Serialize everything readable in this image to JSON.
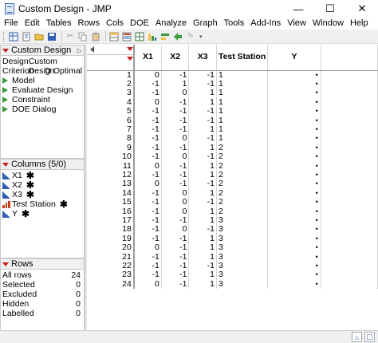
{
  "window": {
    "title": "Custom Design - JMP",
    "controls": [
      "—",
      "☐",
      "✕"
    ]
  },
  "menu": [
    "File",
    "Edit",
    "Tables",
    "Rows",
    "Cols",
    "DOE",
    "Analyze",
    "Graph",
    "Tools",
    "Add-Ins",
    "View",
    "Window",
    "Help"
  ],
  "table_panel": {
    "title": "Custom Design",
    "design_label": "Design",
    "design_value": "Custom Design",
    "criterion_label": "Criterion",
    "criterion_value": "D Optimal",
    "scripts": [
      "Model",
      "Evaluate Design",
      "Constraint",
      "DOE Dialog"
    ]
  },
  "columns_panel": {
    "title": "Columns (5/0)",
    "items": [
      {
        "name": "X1",
        "type": "continuous"
      },
      {
        "name": "X2",
        "type": "continuous"
      },
      {
        "name": "X3",
        "type": "continuous"
      },
      {
        "name": "Test Station",
        "type": "ordinal"
      },
      {
        "name": "Y",
        "type": "continuous"
      }
    ]
  },
  "rows_panel": {
    "title": "Rows",
    "items": [
      {
        "label": "All rows",
        "value": "24"
      },
      {
        "label": "Selected",
        "value": "0"
      },
      {
        "label": "Excluded",
        "value": "0"
      },
      {
        "label": "Hidden",
        "value": "0"
      },
      {
        "label": "Labelled",
        "value": "0"
      }
    ]
  },
  "grid": {
    "headers": [
      "X1",
      "X2",
      "X3",
      "Test Station",
      "Y"
    ],
    "rows": [
      [
        "0",
        "-1",
        "-1",
        "1",
        "•"
      ],
      [
        "-1",
        "1",
        "-1",
        "1",
        "•"
      ],
      [
        "-1",
        "0",
        "1",
        "1",
        "•"
      ],
      [
        "0",
        "-1",
        "1",
        "1",
        "•"
      ],
      [
        "-1",
        "-1",
        "-1",
        "1",
        "•"
      ],
      [
        "-1",
        "-1",
        "-1",
        "1",
        "•"
      ],
      [
        "-1",
        "-1",
        "1",
        "1",
        "•"
      ],
      [
        "-1",
        "0",
        "-1",
        "1",
        "•"
      ],
      [
        "-1",
        "-1",
        "1",
        "2",
        "•"
      ],
      [
        "-1",
        "0",
        "-1",
        "2",
        "•"
      ],
      [
        "0",
        "-1",
        "1",
        "2",
        "•"
      ],
      [
        "-1",
        "-1",
        "1",
        "2",
        "•"
      ],
      [
        "0",
        "-1",
        "-1",
        "2",
        "•"
      ],
      [
        "-1",
        "0",
        "1",
        "2",
        "•"
      ],
      [
        "-1",
        "0",
        "-1",
        "2",
        "•"
      ],
      [
        "-1",
        "0",
        "1",
        "2",
        "•"
      ],
      [
        "-1",
        "-1",
        "1",
        "3",
        "•"
      ],
      [
        "-1",
        "0",
        "-1",
        "3",
        "•"
      ],
      [
        "-1",
        "-1",
        "1",
        "3",
        "•"
      ],
      [
        "0",
        "-1",
        "1",
        "3",
        "•"
      ],
      [
        "-1",
        "-1",
        "1",
        "3",
        "•"
      ],
      [
        "-1",
        "-1",
        "-1",
        "3",
        "•"
      ],
      [
        "-1",
        "-1",
        "1",
        "3",
        "•"
      ],
      [
        "0",
        "-1",
        "1",
        "3",
        "•"
      ]
    ]
  },
  "colors": {
    "red_triangle": "#c81e1e",
    "script_green": "#3d9a3d",
    "continuous_blue": "#2f5fb3",
    "ordinal_red": "#c83a1a"
  }
}
